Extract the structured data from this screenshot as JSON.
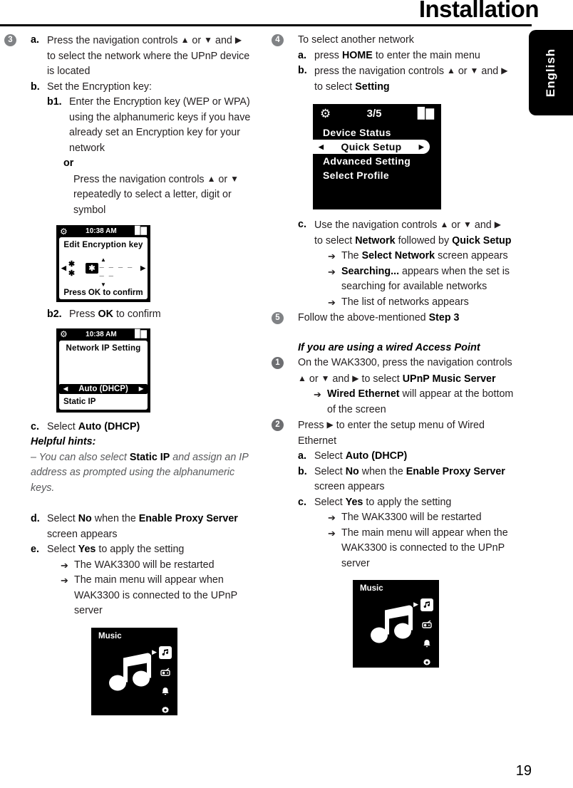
{
  "header": {
    "title": "Installation",
    "language_tab": "English"
  },
  "page_number": "19",
  "left_column": {
    "step3": {
      "number": "3",
      "a": {
        "mark": "a.",
        "text_1": "Press the navigation controls ",
        "nav_up": "▲",
        "or": " or ",
        "nav_down": "▼",
        "and": " and ",
        "nav_right": "▶",
        "text_2": "to select the network where the UPnP device is located"
      },
      "b": {
        "mark": "b.",
        "label": "Set the Encryption key:",
        "b1": {
          "mark": "b1.",
          "text": "Enter the Encryption key (WEP or WPA) using the alphanumeric keys if you have already set an Encryption key for your network"
        },
        "or_label": "or",
        "or_text_1": "Press the navigation controls ",
        "or_text_2": " or ",
        "or_text_3": " repeatedly to select a letter, digit or symbol",
        "b2": {
          "mark": "b2.",
          "text_1": "Press ",
          "bold": "OK",
          "text_2": " to confirm"
        }
      },
      "c": {
        "mark": "c.",
        "text_1": "Select ",
        "bold": "Auto (DHCP)"
      },
      "hints_title": "Helpful hints:",
      "hint_1": "– You can also select ",
      "hint_bold": "Static IP",
      "hint_2": "  and assign an IP address as prompted using the alphanumeric keys.",
      "d": {
        "mark": "d.",
        "text_1": "Select ",
        "bold_1": "No",
        "text_2": " when the ",
        "bold_2": "Enable Proxy Server",
        "text_3": " screen appears"
      },
      "e": {
        "mark": "e.",
        "text_1": "Select ",
        "bold_1": "Yes",
        "text_2": " to apply the setting",
        "arrows": [
          "The WAK3300 will be restarted",
          "The main menu will appear when WAK3300 is connected to the UPnP server"
        ]
      }
    },
    "lcd_encryption": {
      "clock": "10:38 AM",
      "gear_icon": "gear-icon",
      "signal_icon": "signal-icon",
      "title": "Edit Encryption key",
      "up_arrow": "▲",
      "down_arrow": "▼",
      "left_caret": "◀",
      "right_caret": "▶",
      "stars": "✱ ✱",
      "selected_char": "✱",
      "blanks": "_ _ _ _ _ _",
      "footer": "Press OK to confirm"
    },
    "lcd_network_ip": {
      "clock": "10:38 AM",
      "title": "Network IP Setting",
      "items": [
        {
          "label": "Auto (DHCP)",
          "selected": true
        },
        {
          "label": "Static IP",
          "selected": false
        }
      ],
      "left_caret": "◀",
      "right_caret": "▶"
    },
    "lcd_music": {
      "label": "Music",
      "caret": "▶",
      "rail": [
        {
          "icon": "music-note-icon",
          "glyph": "♫",
          "active": true
        },
        {
          "icon": "radio-icon",
          "glyph": "◉",
          "active": false
        },
        {
          "icon": "alarm-bell-icon",
          "glyph": "▲",
          "active": false
        },
        {
          "icon": "settings-gear-icon",
          "glyph": "⚙",
          "active": false
        }
      ]
    }
  },
  "right_column": {
    "step4": {
      "number": "4",
      "heading": "To select another network",
      "a": {
        "mark": "a.",
        "text_1": "press ",
        "bold": "HOME",
        "text_2": " to enter the main menu"
      },
      "b": {
        "mark": "b.",
        "text_1": "press the navigation controls ",
        "text_2": " or ",
        "text_3": " and ",
        "text_4": "to select ",
        "bold": "Setting"
      },
      "c": {
        "mark": "c.",
        "text_1": "Use the navigation controls ",
        "text_2": " or ",
        "text_3": " and ",
        "text_4": "to select ",
        "bold_1": "Network",
        "text_5": " followed by ",
        "bold_2": "Quick Setup",
        "arrows": [
          {
            "bold": "Select Network",
            "rest": " screen appears",
            "lead": "The "
          },
          {
            "bold": "Searching...",
            "rest": " appears when the set is searching for available networks",
            "lead": ""
          },
          {
            "bold": "",
            "rest": "The list of networks appears",
            "lead": ""
          }
        ]
      }
    },
    "step5": {
      "number": "5",
      "text_1": "Follow the above-mentioned ",
      "bold": "Step 3"
    },
    "wired_heading": "If you are using a wired Access Point",
    "wired_step1": {
      "number": "1",
      "text_1": "On the WAK3300, press the navigation controls ",
      "text_2": " or ",
      "text_3": " and ",
      "text_4": " to select ",
      "bold": "UPnP Music Server",
      "arrow_bold": "Wired Ethernet",
      "arrow_rest": " will appear at the bottom of the screen"
    },
    "wired_step2": {
      "number": "2",
      "text_1": "Press ",
      "nav_right": "▶",
      "text_2": " to enter the setup menu of Wired Ethernet",
      "a": {
        "mark": "a.",
        "text_1": "Select ",
        "bold": "Auto (DHCP)"
      },
      "b": {
        "mark": "b.",
        "text_1": "Select ",
        "bold_1": "No",
        "text_2": " when the ",
        "bold_2": "Enable Proxy Server",
        "text_3": " screen appears"
      },
      "c": {
        "mark": "c.",
        "text_1": "Select ",
        "bold_1": "Yes",
        "text_2": " to apply the setting",
        "arrows": [
          "The WAK3300 will be restarted",
          "The main menu will appear when the WAK3300 is connected to the UPnP server"
        ]
      }
    },
    "lcd_settings": {
      "page_indicator": "3/5",
      "gear_icon": "gear-icon",
      "signal_icon": "signal-icon",
      "items": [
        {
          "label": "Device Status",
          "selected": false
        },
        {
          "label": "Quick Setup",
          "selected": true
        },
        {
          "label": "Advanced Setting",
          "selected": false
        },
        {
          "label": "Select Profile",
          "selected": false
        }
      ],
      "left_caret": "◀",
      "right_caret": "▶"
    },
    "lcd_music": {
      "label": "Music",
      "caret": "▶",
      "rail": [
        {
          "icon": "music-note-icon",
          "glyph": "♫",
          "active": true
        },
        {
          "icon": "radio-icon",
          "glyph": "◉",
          "active": false
        },
        {
          "icon": "alarm-bell-icon",
          "glyph": "▲",
          "active": false
        },
        {
          "icon": "settings-gear-icon",
          "glyph": "⚙",
          "active": false
        }
      ]
    }
  },
  "glyphs": {
    "arrow_right_bullet": "➔",
    "nav_up": "▲",
    "nav_down": "▼",
    "nav_right": "▶"
  }
}
